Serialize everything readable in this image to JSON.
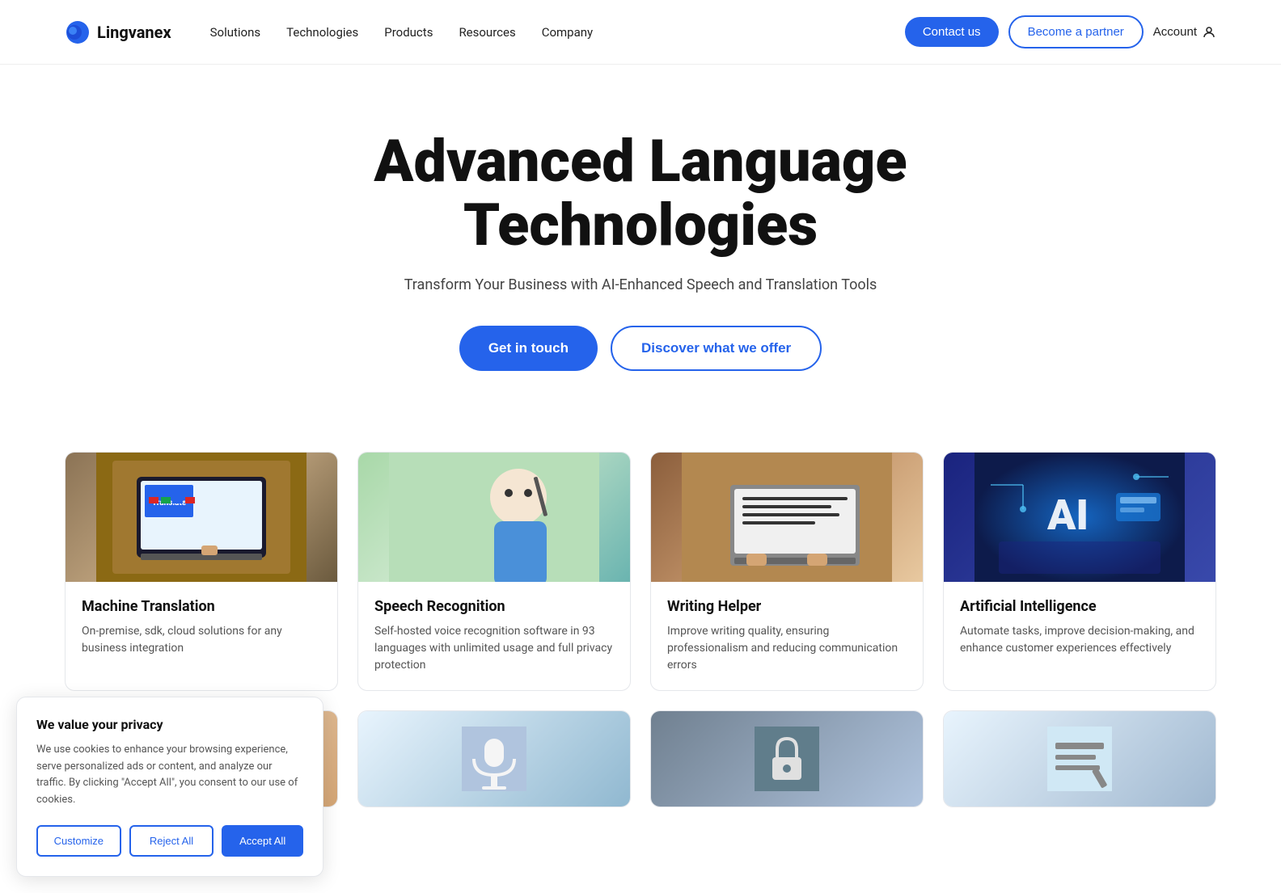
{
  "navbar": {
    "logo_text": "Lingvanex",
    "links": [
      {
        "label": "Solutions",
        "id": "solutions"
      },
      {
        "label": "Technologies",
        "id": "technologies"
      },
      {
        "label": "Products",
        "id": "products"
      },
      {
        "label": "Resources",
        "id": "resources"
      },
      {
        "label": "Company",
        "id": "company"
      }
    ],
    "contact_label": "Contact us",
    "partner_label": "Become a partner",
    "account_label": "Account"
  },
  "hero": {
    "title_line1": "Advanced Language",
    "title_line2": "Technologies",
    "subtitle": "Transform Your Business with AI-Enhanced Speech and Translation Tools",
    "cta_primary": "Get in touch",
    "cta_secondary": "Discover what we offer"
  },
  "cards": [
    {
      "id": "machine-translation",
      "title": "Machine Translation",
      "description": "On-premise, sdk, cloud solutions for any business integration",
      "image_class": "img-machine-translation",
      "image_emoji": "💻"
    },
    {
      "id": "speech-recognition",
      "title": "Speech Recognition",
      "description": "Self-hosted voice recognition software in 93 languages with unlimited usage and full privacy protection",
      "image_class": "img-speech-recognition",
      "image_emoji": "🎤"
    },
    {
      "id": "writing-helper",
      "title": "Writing Helper",
      "description": "Improve writing quality, ensuring professionalism and reducing communication errors",
      "image_class": "img-writing-helper",
      "image_emoji": "⌨️"
    },
    {
      "id": "artificial-intelligence",
      "title": "Artificial Intelligence",
      "description": "Automate tasks, improve decision-making, and enhance customer experiences effectively",
      "image_class": "img-ai",
      "image_emoji": "🤖"
    }
  ],
  "cards_row2": [
    {
      "id": "partial1",
      "image_class": "img-partial1",
      "image_emoji": "👥"
    },
    {
      "id": "partial2",
      "image_class": "img-partial2",
      "image_emoji": "🔒"
    },
    {
      "id": "partial3",
      "image_class": "img-partial3",
      "image_emoji": "📝"
    }
  ],
  "cookie": {
    "title": "We value your privacy",
    "text": "We use cookies to enhance your browsing experience, serve personalized ads or content, and analyze our traffic. By clicking \"Accept All\", you consent to our use of cookies.",
    "customize_label": "Customize",
    "reject_label": "Reject All",
    "accept_label": "Accept All"
  }
}
